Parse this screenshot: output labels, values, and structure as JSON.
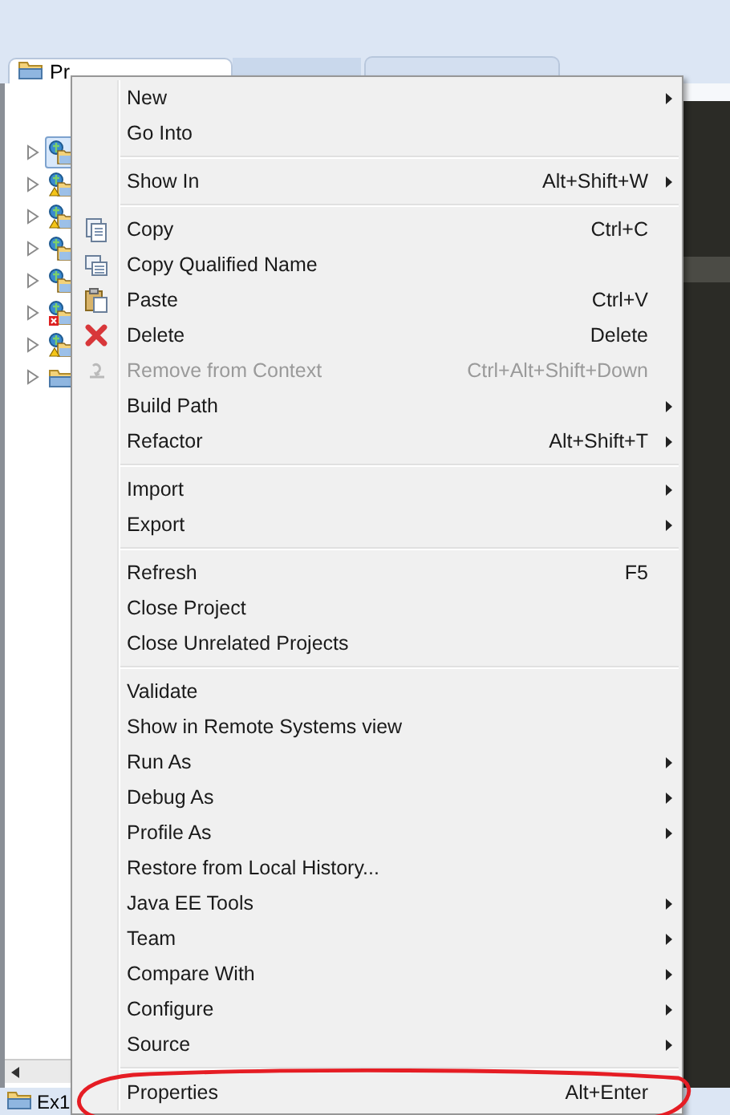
{
  "explorer_tab": {
    "label": "Pr"
  },
  "tree_rows": [
    {
      "kind": "project",
      "has_warning": false,
      "has_error": false,
      "selected": true
    },
    {
      "kind": "project",
      "has_warning": true,
      "has_error": false,
      "selected": false
    },
    {
      "kind": "project",
      "has_warning": true,
      "has_error": false,
      "selected": false
    },
    {
      "kind": "project",
      "has_warning": false,
      "has_error": false,
      "selected": false
    },
    {
      "kind": "project",
      "has_warning": false,
      "has_error": false,
      "selected": false
    },
    {
      "kind": "project",
      "has_warning": false,
      "has_error": true,
      "selected": false
    },
    {
      "kind": "project",
      "has_warning": true,
      "has_error": false,
      "selected": false
    },
    {
      "kind": "folder",
      "has_warning": false,
      "has_error": false,
      "selected": false
    }
  ],
  "context_menu": {
    "groups": [
      [
        {
          "label": "New",
          "submenu": true
        },
        {
          "label": "Go Into"
        }
      ],
      [
        {
          "label": "Show In",
          "shortcut": "Alt+Shift+W",
          "submenu": true
        }
      ],
      [
        {
          "label": "Copy",
          "shortcut": "Ctrl+C",
          "kind": "copy"
        },
        {
          "label": "Copy Qualified Name",
          "kind": "copy-name"
        },
        {
          "label": "Paste",
          "shortcut": "Ctrl+V",
          "kind": "paste"
        },
        {
          "label": "Delete",
          "shortcut": "Delete",
          "kind": "delete"
        },
        {
          "label": "Remove from Context",
          "shortcut": "Ctrl+Alt+Shift+Down",
          "kind": "remove",
          "disabled": true
        },
        {
          "label": "Build Path",
          "submenu": true
        },
        {
          "label": "Refactor",
          "shortcut": "Alt+Shift+T",
          "submenu": true
        }
      ],
      [
        {
          "label": "Import",
          "submenu": true
        },
        {
          "label": "Export",
          "submenu": true
        }
      ],
      [
        {
          "label": "Refresh",
          "shortcut": "F5"
        },
        {
          "label": "Close Project"
        },
        {
          "label": "Close Unrelated Projects"
        }
      ],
      [
        {
          "label": "Validate"
        },
        {
          "label": "Show in Remote Systems view"
        },
        {
          "label": "Run As",
          "submenu": true
        },
        {
          "label": "Debug As",
          "submenu": true
        },
        {
          "label": "Profile As",
          "submenu": true
        },
        {
          "label": "Restore from Local History..."
        },
        {
          "label": "Java EE Tools",
          "submenu": true
        },
        {
          "label": "Team",
          "submenu": true
        },
        {
          "label": "Compare With",
          "submenu": true
        },
        {
          "label": "Configure",
          "submenu": true
        },
        {
          "label": "Source",
          "submenu": true
        }
      ],
      [
        {
          "label": "Properties",
          "shortcut": "Alt+Enter",
          "highlighted": true
        }
      ]
    ]
  },
  "bottom_tab": {
    "label": "Ex1"
  }
}
